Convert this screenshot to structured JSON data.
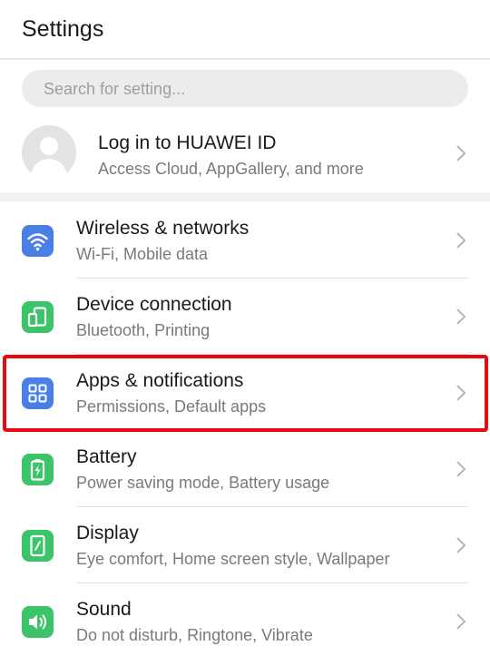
{
  "header": {
    "title": "Settings"
  },
  "search": {
    "placeholder": "Search for setting..."
  },
  "account": {
    "title": "Log in to HUAWEI ID",
    "subtitle": "Access Cloud, AppGallery, and more",
    "icon": "avatar-icon"
  },
  "items": [
    {
      "title": "Wireless & networks",
      "subtitle": "Wi-Fi, Mobile data",
      "icon": "wifi-icon",
      "color": "#4a7fe6"
    },
    {
      "title": "Device connection",
      "subtitle": "Bluetooth, Printing",
      "icon": "device-connection-icon",
      "color": "#3cc46a"
    },
    {
      "title": "Apps & notifications",
      "subtitle": "Permissions, Default apps",
      "icon": "apps-grid-icon",
      "color": "#4a7fe6"
    },
    {
      "title": "Battery",
      "subtitle": "Power saving mode, Battery usage",
      "icon": "battery-icon",
      "color": "#3cc46a"
    },
    {
      "title": "Display",
      "subtitle": "Eye comfort, Home screen style, Wallpaper",
      "icon": "display-icon",
      "color": "#3cc46a"
    },
    {
      "title": "Sound",
      "subtitle": "Do not disturb, Ringtone, Vibrate",
      "icon": "speaker-icon",
      "color": "#3cc46a"
    }
  ],
  "highlight": {
    "target": "Apps & notifications",
    "color": "#e8080e"
  }
}
